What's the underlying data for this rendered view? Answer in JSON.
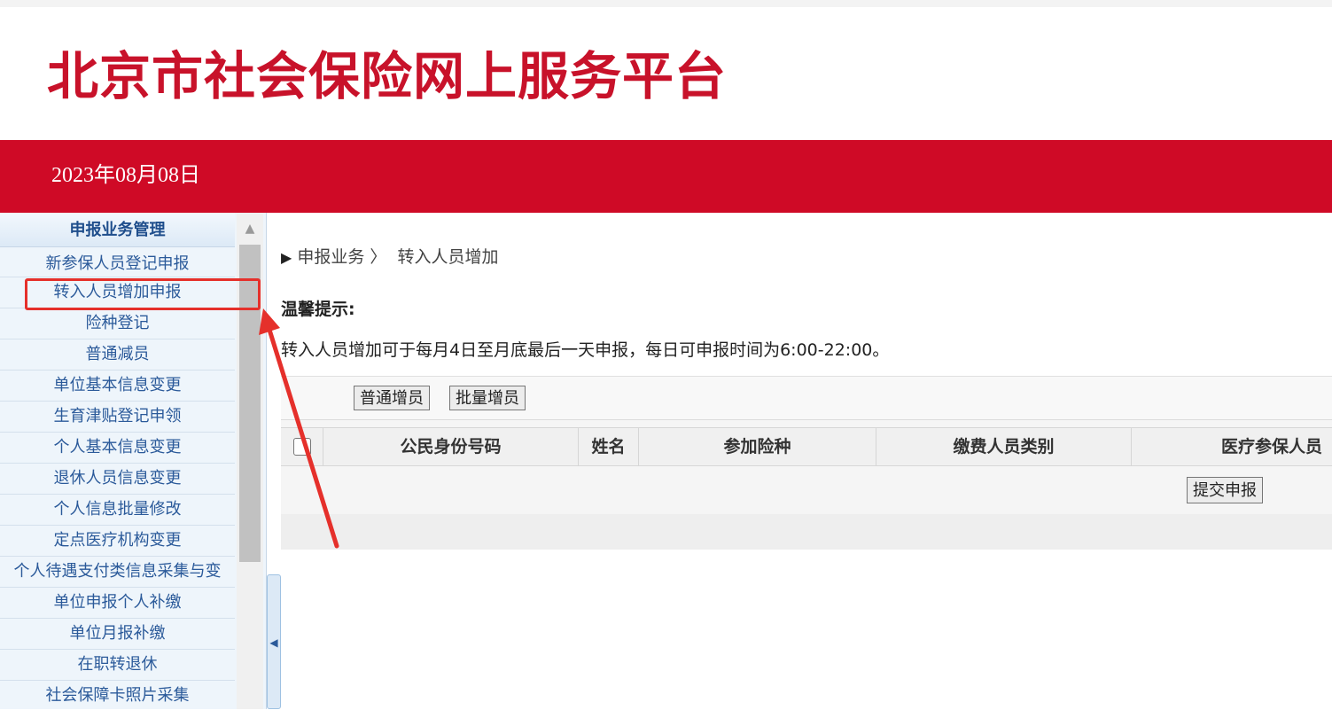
{
  "header": {
    "site_title": "北京市社会保险网上服务平台",
    "date": "2023年08月08日"
  },
  "sidebar": {
    "section_title": "申报业务管理",
    "items": [
      {
        "label": "新参保人员登记申报"
      },
      {
        "label": "转入人员增加申报",
        "highlighted": true
      },
      {
        "label": "险种登记"
      },
      {
        "label": "普通减员"
      },
      {
        "label": "单位基本信息变更"
      },
      {
        "label": "生育津贴登记申领"
      },
      {
        "label": "个人基本信息变更"
      },
      {
        "label": "退休人员信息变更"
      },
      {
        "label": "个人信息批量修改"
      },
      {
        "label": "定点医疗机构变更"
      },
      {
        "label": "个人待遇支付类信息采集与变"
      },
      {
        "label": "单位申报个人补缴"
      },
      {
        "label": "单位月报补缴"
      },
      {
        "label": "在职转退休"
      },
      {
        "label": "社会保障卡照片采集"
      }
    ]
  },
  "breadcrumb": {
    "parent": "申报业务 〉",
    "current": "转入人员增加"
  },
  "tips": {
    "title": "温馨提示:",
    "text": "转入人员增加可于每月4日至月底最后一天申报，每日可申报时间为6:00-22:00。"
  },
  "toolbar": {
    "normal_add_label": "普通增员",
    "batch_add_label": "批量增员"
  },
  "table": {
    "columns": [
      "公民身份号码",
      "姓名",
      "参加险种",
      "缴费人员类别",
      "医疗参保人员"
    ]
  },
  "submit_label": "提交申报",
  "colors": {
    "brand_red": "#cf0a26",
    "title_red": "#c8122a",
    "annotation_red": "#e5302b",
    "menu_blue": "#2b5a9a"
  }
}
